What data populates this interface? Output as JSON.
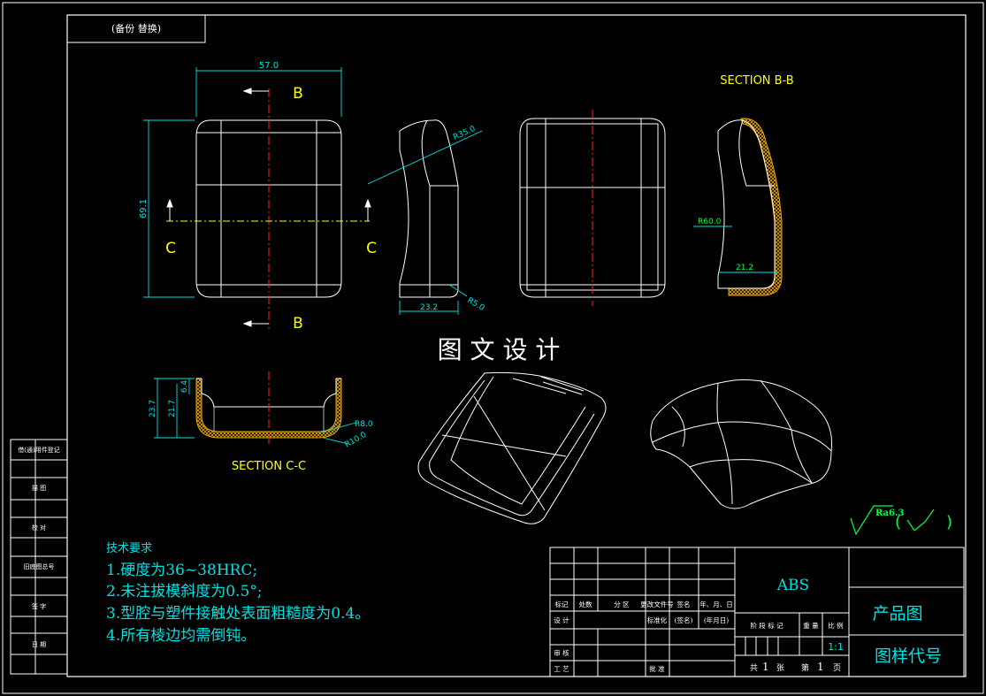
{
  "title_tag": "(备份 替换)",
  "watermark": "图 文 设 计",
  "sections": {
    "bb": "SECTION B-B",
    "cc": "SECTION C-C"
  },
  "labels": {
    "B_top": "B",
    "B_bottom": "B",
    "C_left": "C",
    "C_right": "C"
  },
  "dimensions": {
    "width_57": "57.0",
    "height_69": "69.1",
    "r35": "R35.0",
    "r5": "R5.0",
    "w232": "23.2",
    "r60": "R60.0",
    "w212": "21.2",
    "h237": "23.7",
    "h217": "21.7",
    "h64": "6.4",
    "r8": "R8.0",
    "r10": "R10.0"
  },
  "tech_requirements": {
    "heading": "技术要求",
    "items": [
      "1.硬度为36~38HRC;",
      "2.未注拔模斜度为0.5°;",
      "3.型腔与塑件接触处表面粗糙度为0.4。",
      "4.所有棱边均需倒钝。"
    ]
  },
  "roughness": {
    "value": "Ra6.3",
    "paren_open": "(",
    "paren_close": ")"
  },
  "left_strip": [
    "借(通)用件登记",
    "描 图",
    "校 对",
    "旧底图总号",
    "签 字",
    "日 期"
  ],
  "title_block": {
    "material": "ABS",
    "product": "产品图",
    "drawing_no": "图样代号",
    "scale": "1:1",
    "rev_headers": [
      "标记",
      "处数",
      "分 区",
      "更改文件号",
      "签名",
      "年、月、日"
    ],
    "design": "设 计",
    "std": "标准化",
    "sign": "(签名)",
    "date": "(年月日)",
    "review": "审 核",
    "process": "工 艺",
    "approve": "批 准",
    "stage_headers": [
      "阶 段 标 记",
      "重 量",
      "比 例"
    ],
    "sheets_total_label": "共",
    "sheets_total": "1",
    "sheets_unit": "张",
    "sheet_no_label": "第",
    "sheet_no": "1",
    "sheet_unit": "页"
  },
  "colors": {
    "outline": "#ffffff",
    "dim": "#00e0e0",
    "center": "#ff2020",
    "label": "#ffff00",
    "section_fill": "#e8a400",
    "green": "#00ff40",
    "note": "#00e0e0"
  }
}
